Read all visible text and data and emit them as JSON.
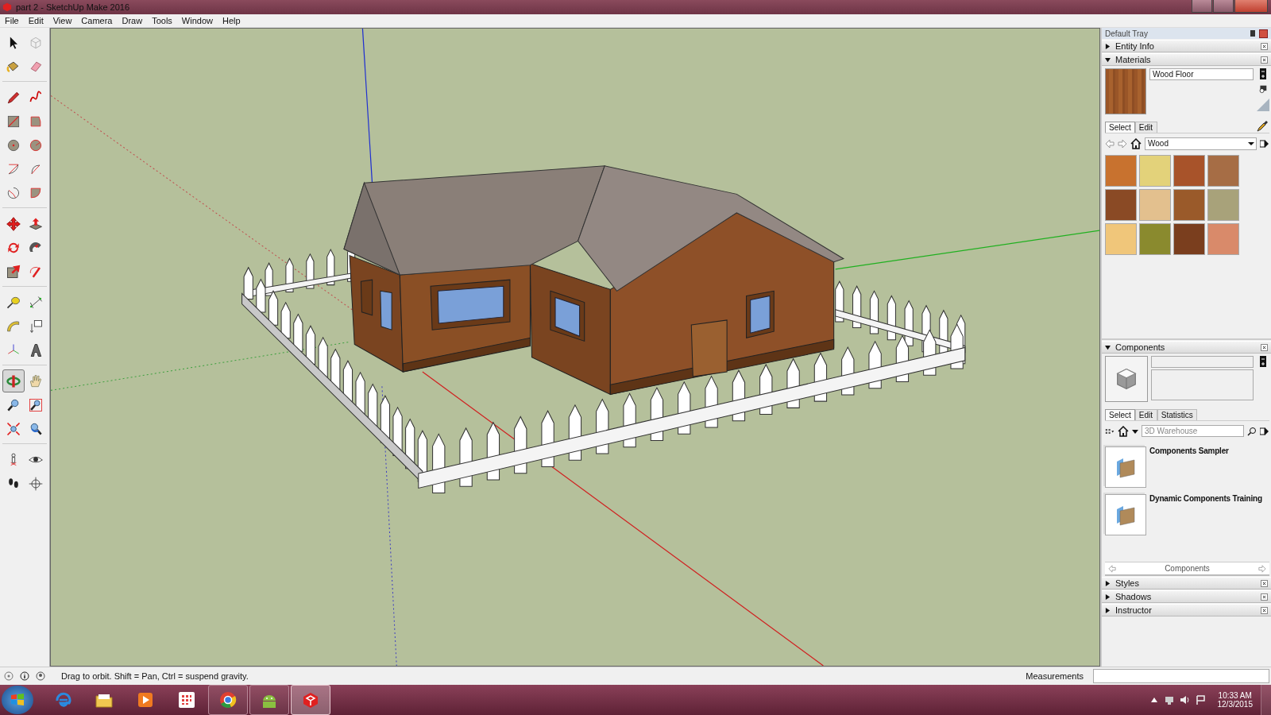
{
  "window": {
    "title": "part 2 - SketchUp Make 2016"
  },
  "menu": [
    "File",
    "Edit",
    "View",
    "Camera",
    "Draw",
    "Tools",
    "Window",
    "Help"
  ],
  "toolbar": {
    "groups": [
      [
        {
          "kind": "select",
          "selected": false
        },
        {
          "kind": "component",
          "selected": false
        },
        {
          "kind": "paint",
          "selected": false
        },
        {
          "kind": "eraser",
          "selected": false
        }
      ],
      [
        {
          "kind": "pencil",
          "selected": false
        },
        {
          "kind": "freehand",
          "selected": false
        },
        {
          "kind": "rectangle",
          "selected": false
        },
        {
          "kind": "rotated-rectangle",
          "selected": false
        },
        {
          "kind": "circle",
          "selected": false
        },
        {
          "kind": "polygon",
          "selected": false
        },
        {
          "kind": "arc",
          "selected": false
        },
        {
          "kind": "pie-arc",
          "selected": false
        },
        {
          "kind": "three-point-arc",
          "selected": false
        },
        {
          "kind": "pie",
          "selected": false
        }
      ],
      [
        {
          "kind": "move",
          "selected": false
        },
        {
          "kind": "push-pull",
          "selected": false
        },
        {
          "kind": "rotate",
          "selected": false
        },
        {
          "kind": "follow-me",
          "selected": false
        },
        {
          "kind": "scale",
          "selected": false
        },
        {
          "kind": "offset",
          "selected": false
        }
      ],
      [
        {
          "kind": "tape",
          "selected": false
        },
        {
          "kind": "dimension",
          "selected": false
        },
        {
          "kind": "protractor",
          "selected": false
        },
        {
          "kind": "text",
          "selected": false
        },
        {
          "kind": "axes",
          "selected": false
        },
        {
          "kind": "text3d",
          "selected": false
        }
      ],
      [
        {
          "kind": "orbit",
          "selected": true
        },
        {
          "kind": "pan",
          "selected": false
        },
        {
          "kind": "zoom",
          "selected": false
        },
        {
          "kind": "zoom-window",
          "selected": false
        },
        {
          "kind": "zoom-extents",
          "selected": false
        },
        {
          "kind": "previous",
          "selected": false
        }
      ],
      [
        {
          "kind": "position-camera",
          "selected": false
        },
        {
          "kind": "look-around",
          "selected": false
        },
        {
          "kind": "walk",
          "selected": false
        },
        {
          "kind": "section",
          "selected": false
        }
      ]
    ]
  },
  "tray": {
    "title": "Default Tray",
    "sections": [
      {
        "title": "Entity Info",
        "expanded": false
      },
      {
        "kind": "materials",
        "title": "Materials",
        "expanded": true,
        "material_name": "Wood Floor",
        "tabs": [
          {
            "label": "Select",
            "selected": true
          },
          {
            "label": "Edit",
            "selected": false
          }
        ],
        "collection": "Wood",
        "swatches": [
          {
            "color": "#c8722f"
          },
          {
            "color": "#e3d27a"
          },
          {
            "color": "#a8532a"
          },
          {
            "color": "#a66d45"
          },
          {
            "color": "#8a4a25"
          },
          {
            "color": "#e3c08e"
          },
          {
            "color": "#9a5a2a"
          },
          {
            "color": "#a8a27a"
          },
          {
            "color": "#f0c67a"
          },
          {
            "color": "#8a8a2e"
          },
          {
            "color": "#7a3e1e"
          },
          {
            "color": "#d98a6a"
          }
        ]
      },
      {
        "kind": "components",
        "title": "Components",
        "expanded": true,
        "tabs": [
          {
            "label": "Select",
            "selected": true
          },
          {
            "label": "Edit",
            "selected": false
          },
          {
            "label": "Statistics",
            "selected": false
          }
        ],
        "search": {
          "placeholder": "3D Warehouse"
        },
        "items": [
          {
            "name": "Components Sampler"
          },
          {
            "name": "Dynamic Components Training"
          }
        ],
        "footer": "Components"
      },
      {
        "title": "Styles",
        "expanded": false
      },
      {
        "title": "Shadows",
        "expanded": false
      },
      {
        "title": "Instructor",
        "expanded": false
      }
    ]
  },
  "status_bar": {
    "message": "Drag to orbit. Shift = Pan, Ctrl = suspend gravity.",
    "measurements_label": "Measurements"
  },
  "taskbar": {
    "apps": [
      {
        "kind": "browser-e",
        "running": false,
        "selected": false
      },
      {
        "kind": "folder",
        "running": false,
        "selected": false
      },
      {
        "kind": "media",
        "running": false,
        "selected": false
      },
      {
        "kind": "grid",
        "running": false,
        "selected": false
      },
      {
        "kind": "chrome",
        "running": true,
        "selected": false
      },
      {
        "kind": "android",
        "running": true,
        "selected": false
      },
      {
        "kind": "sketchup",
        "running": true,
        "selected": true
      }
    ],
    "time": "10:33 AM",
    "date": "12/3/2015"
  }
}
